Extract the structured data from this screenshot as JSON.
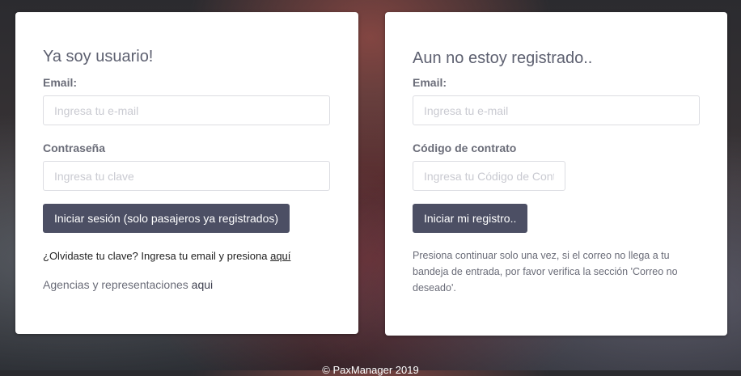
{
  "login": {
    "title": "Ya soy usuario!",
    "email_label": "Email:",
    "email_placeholder": "Ingresa tu e-mail",
    "password_label": "Contraseña",
    "password_placeholder": "Ingresa tu clave",
    "submit_label": "Iniciar sesión (solo pasajeros ya registrados)",
    "forgot_text": "¿Olvidaste tu clave? Ingresa tu email y presiona",
    "forgot_link": "aquí",
    "agencies_text": "Agencias y representaciones",
    "agencies_link": "aqui"
  },
  "register": {
    "title": "Aun no estoy registrado..",
    "email_label": "Email:",
    "email_placeholder": "Ingresa tu e-mail",
    "contract_label": "Código de contrato",
    "contract_placeholder": "Ingresa tu Código de Contrato",
    "submit_label": "Iniciar mi registro..",
    "note": "Presiona continuar solo una vez, si el correo no llega a tu bandeja de entrada, por favor verifica la sección 'Correo no deseado'."
  },
  "footer": {
    "text": "© PaxManager 2019"
  }
}
